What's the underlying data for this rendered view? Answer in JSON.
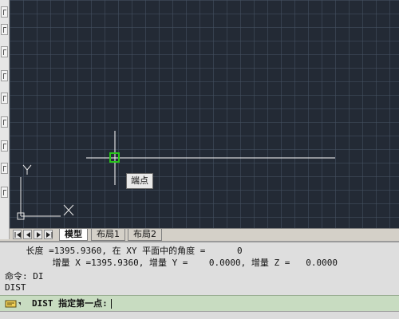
{
  "canvas": {
    "tooltip": "端点"
  },
  "layout_tabs": {
    "items": [
      {
        "label": "模型",
        "active": true
      },
      {
        "label": "布局1",
        "active": false
      },
      {
        "label": "布局2",
        "active": false
      }
    ]
  },
  "command_history": {
    "line1": "    长度 =1395.9360, 在 XY 平面中的角度 =      0",
    "line2": "         增量 X =1395.9360, 增量 Y =    0.0000, 增量 Z =   0.0000",
    "line3": "命令: DI",
    "line4": "DIST"
  },
  "command_prompt": {
    "text": "DIST 指定第一点:"
  },
  "colors": {
    "canvas_bg": "#232a35",
    "osnap_marker": "#27c41a",
    "line": "#ffffff",
    "prompt_bg": "#c8dcc1"
  },
  "icons": {
    "ucs": "ucs-icon",
    "osnap": "endpoint-snap-marker-icon",
    "prompt": "command-line-icon"
  }
}
